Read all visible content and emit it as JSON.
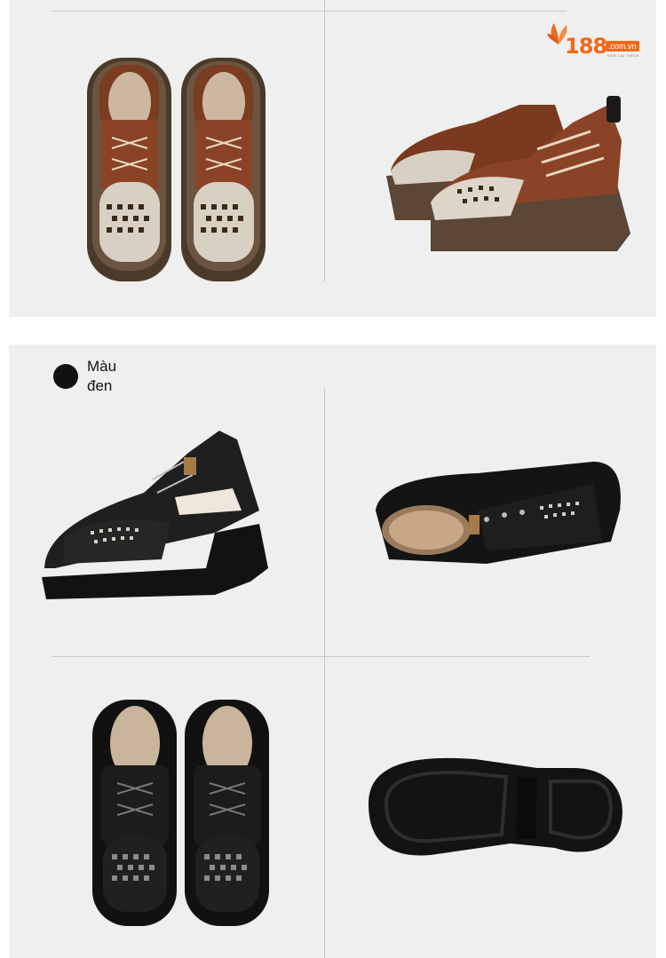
{
  "brand": {
    "number": "188",
    "domain": ".com.vn",
    "tagline": "ĐEM LẠI THÍCH",
    "accent_color": "#f06a1a"
  },
  "color_option": {
    "label_line1": "Màu",
    "label_line2": "đen",
    "swatch_color": "#111111"
  },
  "photos": [
    {
      "name": "brown-shoes-top-view",
      "color": "brown"
    },
    {
      "name": "brown-shoes-side-view",
      "color": "brown"
    },
    {
      "name": "black-shoe-side-view",
      "color": "black"
    },
    {
      "name": "black-shoe-angled-view",
      "color": "black"
    },
    {
      "name": "black-shoes-top-view",
      "color": "black"
    },
    {
      "name": "black-shoe-sole-view",
      "color": "black"
    }
  ]
}
